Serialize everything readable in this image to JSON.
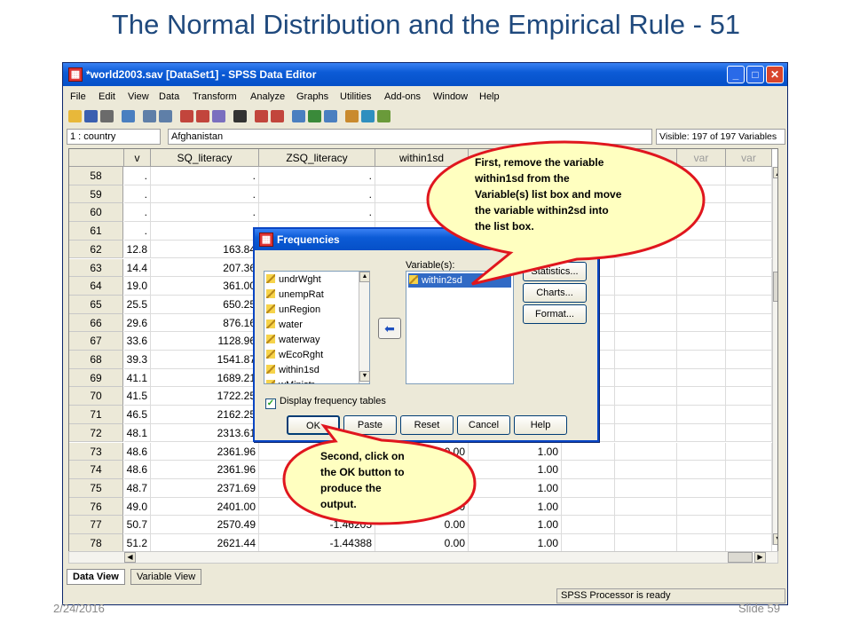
{
  "slide": {
    "title": "The Normal Distribution and the Empirical Rule - 51",
    "date": "2/24/2016",
    "slide_number": "Slide 59"
  },
  "window": {
    "title": "*world2003.sav [DataSet1] - SPSS Data Editor",
    "menu": [
      "File",
      "Edit",
      "View",
      "Data",
      "Transform",
      "Analyze",
      "Graphs",
      "Utilities",
      "Add-ons",
      "Window",
      "Help"
    ],
    "cell_ref": "1 : country",
    "cell_value": "Afghanistan",
    "visible": "Visible: 197 of 197 Variables",
    "columns": [
      "v",
      "SQ_literacy",
      "ZSQ_literacy",
      "within1sd",
      "",
      "",
      "var",
      "var"
    ],
    "rows": [
      {
        "n": "58",
        "c1": ".",
        "c2": ".",
        "c3": ".",
        "c4": "",
        "c5": ""
      },
      {
        "n": "59",
        "c1": ".",
        "c2": ".",
        "c3": ".",
        "c4": "",
        "c5": ""
      },
      {
        "n": "60",
        "c1": ".",
        "c2": ".",
        "c3": ".",
        "c4": "",
        "c5": ""
      },
      {
        "n": "61",
        "c1": ".",
        "c2": "",
        "c3": "",
        "c4": "",
        "c5": ""
      },
      {
        "n": "62",
        "c1": "12.8",
        "c2": "163.84",
        "c3": "",
        "c4": "",
        "c5": ""
      },
      {
        "n": "63",
        "c1": "14.4",
        "c2": "207.36",
        "c3": "",
        "c4": "",
        "c5": ""
      },
      {
        "n": "64",
        "c1": "19.0",
        "c2": "361.00",
        "c3": "",
        "c4": "",
        "c5": ""
      },
      {
        "n": "65",
        "c1": "25.5",
        "c2": "650.25",
        "c3": "",
        "c4": "",
        "c5": ""
      },
      {
        "n": "66",
        "c1": "29.6",
        "c2": "876.16",
        "c3": "",
        "c4": "",
        "c5": ""
      },
      {
        "n": "67",
        "c1": "33.6",
        "c2": "1128.96",
        "c3": "",
        "c4": "",
        "c5": ""
      },
      {
        "n": "68",
        "c1": "39.3",
        "c2": "1541.87",
        "c3": "",
        "c4": "",
        "c5": ""
      },
      {
        "n": "69",
        "c1": "41.1",
        "c2": "1689.21",
        "c3": "",
        "c4": "",
        "c5": ""
      },
      {
        "n": "70",
        "c1": "41.5",
        "c2": "1722.25",
        "c3": "",
        "c4": "",
        "c5": ""
      },
      {
        "n": "71",
        "c1": "46.5",
        "c2": "2162.25",
        "c3": "",
        "c4": "",
        "c5": ""
      },
      {
        "n": "72",
        "c1": "48.1",
        "c2": "2313.61",
        "c3": "",
        "c4": "",
        "c5": ""
      },
      {
        "n": "73",
        "c1": "48.6",
        "c2": "2361.96",
        "c3": "",
        "c4": "0.00",
        "c5": "1.00"
      },
      {
        "n": "74",
        "c1": "48.6",
        "c2": "2361.96",
        "c3": "",
        "c4": "0.00",
        "c5": "1.00"
      },
      {
        "n": "75",
        "c1": "48.7",
        "c2": "2371.69",
        "c3": "",
        "c4": "0.00",
        "c5": "1.00"
      },
      {
        "n": "76",
        "c1": "49.0",
        "c2": "2401.00",
        "c3": "",
        "c4": "0.00",
        "c5": "1.00"
      },
      {
        "n": "77",
        "c1": "50.7",
        "c2": "2570.49",
        "c3": "-1.46205",
        "c4": "0.00",
        "c5": "1.00"
      },
      {
        "n": "78",
        "c1": "51.2",
        "c2": "2621.44",
        "c3": "-1.44388",
        "c4": "0.00",
        "c5": "1.00"
      }
    ],
    "tabs": [
      "Data View",
      "Variable View"
    ],
    "status": "SPSS  Processor is ready"
  },
  "dialog": {
    "title": "Frequencies",
    "source_vars": [
      "undrWght",
      "unempRat",
      "unRegion",
      "water",
      "waterway",
      "wEcoRght",
      "within1sd",
      "wMinistr"
    ],
    "variables_label": "Variable(s):",
    "selected_var": "within2sd",
    "buttons_right": [
      "Statistics...",
      "Charts...",
      "Format..."
    ],
    "checkbox_label": "Display frequency tables",
    "buttons_bottom": [
      "OK",
      "Paste",
      "Reset",
      "Cancel",
      "Help"
    ]
  },
  "callouts": {
    "first": [
      "First, remove the variable",
      "within1sd from the",
      "Variable(s) list box and move",
      "the variable within2sd into",
      "the list box."
    ],
    "second": [
      "Second, click on",
      "the OK button to",
      "produce the",
      "output."
    ]
  },
  "colors": {
    "title": "#1f497d",
    "callout_fill": "#ffffc0",
    "callout_border": "#e0161e",
    "selection": "#316ac5"
  }
}
